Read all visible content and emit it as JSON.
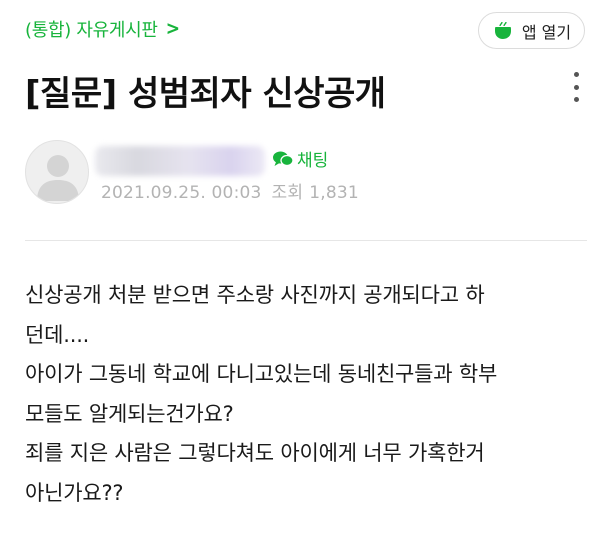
{
  "header": {
    "board_link": "(통합) 자유게시판",
    "board_chevron": ">",
    "app_button_label": "앱 열기"
  },
  "post": {
    "title": "[질문] 성범죄자 신상공개",
    "author": {
      "chat_label": "채팅"
    },
    "date": "2021.09.25. 00:03",
    "views_label": "조회",
    "views": "1,831",
    "body_lines": [
      "신상공개 처분 받으면 주소랑 사진까지 공개되다고 하",
      "던데....",
      "아이가 그동네 학교에 다니고있는데 동네친구들과 학부",
      "모들도 알게되는건가요?",
      "죄를 지은 사람은 그렇다쳐도 아이에게 너무 가혹한거",
      "아닌가요??"
    ]
  },
  "colors": {
    "accent_green": "#18b43c",
    "meta_gray": "#b3b3b3",
    "text": "#1a1a1a"
  },
  "icons": {
    "app": "cup-icon",
    "more": "more-vertical-icon",
    "chat": "chat-bubble-icon",
    "avatar": "default-avatar-icon"
  }
}
